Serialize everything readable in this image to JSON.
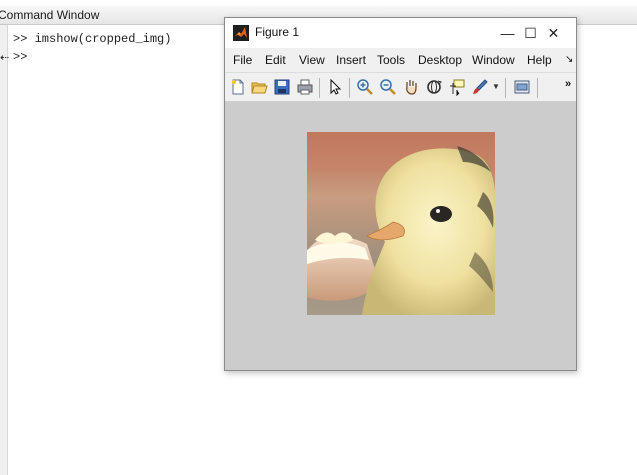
{
  "command_window": {
    "title": "Command Window",
    "lines": [
      ">> imshow(cropped_img)",
      ">>"
    ],
    "marker": "⇠"
  },
  "figure": {
    "title": "Figure 1",
    "controls": {
      "minimize": "—",
      "maximize": "☐",
      "close": "✕"
    },
    "menus": [
      "File",
      "Edit",
      "View",
      "Insert",
      "Tools",
      "Desktop",
      "Window",
      "Help"
    ],
    "menu_overflow": "↘",
    "toolbar": {
      "icons": [
        "new-figure-icon",
        "open-file-icon",
        "save-icon",
        "print-icon",
        "pointer-icon",
        "zoom-in-icon",
        "zoom-out-icon",
        "pan-hand-icon",
        "rotate-3d-icon",
        "data-cursor-icon",
        "brush-icon",
        "dock-icon"
      ],
      "overflow": "»"
    },
    "canvas_color": "#cccccc"
  },
  "image": {
    "subject": "chick-hatching-photo"
  },
  "colors": {
    "titlebar": "#ffffff",
    "chrome": "#f0f0f0",
    "canvas": "#cccccc",
    "matlab_orange": "#e0621d"
  }
}
